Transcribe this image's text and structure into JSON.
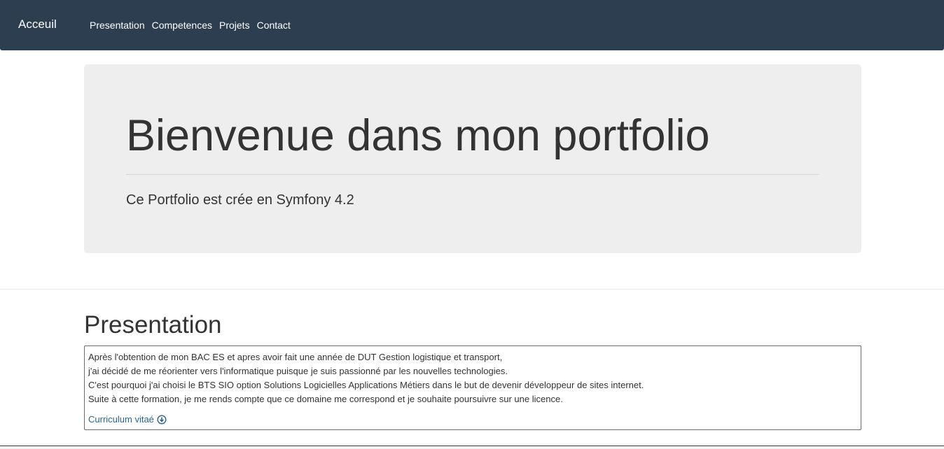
{
  "navbar": {
    "brand": "Acceuil",
    "links": [
      "Presentation",
      "Competences",
      "Projets",
      "Contact"
    ],
    "background": "#2c3e50"
  },
  "jumbotron": {
    "title": "Bienvenue dans mon portfolio",
    "lead": "Ce Portfolio est crée en Symfony 4.2",
    "background": "#eeeeee"
  },
  "presentation": {
    "title": "Presentation",
    "paragraphs": [
      "Après l'obtention de mon BAC ES et apres avoir fait une année de DUT Gestion logistique et transport,",
      "j'ai décidé de me réorienter vers l'informatique puisque je suis passionné par les nouvelles technologies.",
      "C'est pourquoi j'ai choisi le BTS SIO option Solutions Logicielles Applications Métiers dans le but de devenir développeur de sites internet.",
      "Suite à cette formation, je me rends compte que ce domaine me correspond et je souhaite poursuivre sur une licence."
    ],
    "cv_link": "Curriculum vitaé",
    "cv_icon": "download-circle-icon",
    "link_color": "#2a6496"
  }
}
